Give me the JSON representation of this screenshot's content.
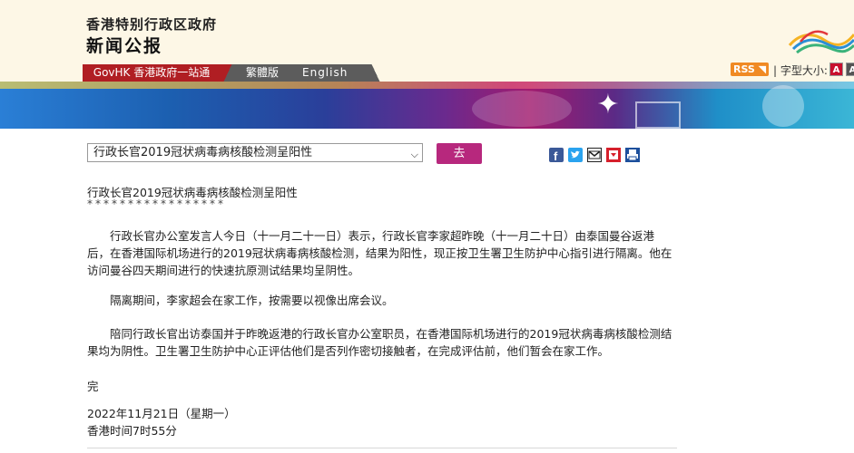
{
  "header": {
    "org_title": "香港特别行政区政府",
    "section_title": "新闻公报"
  },
  "nav": {
    "govhk": "GovHK 香港政府一站通",
    "traditional": "繁體版",
    "english": "English"
  },
  "tools": {
    "rss": "RSS",
    "font_size_label": "| 字型大小:",
    "font_a": "A",
    "font_a2": "A"
  },
  "select": {
    "value": "行政长官2019冠状病毒病核酸检测呈阳性",
    "go_label": "去"
  },
  "share_icons": [
    "facebook-icon",
    "twitter-icon",
    "email-icon",
    "weibo-icon",
    "print-icon"
  ],
  "article": {
    "headline": "行政长官2019冠状病毒病核酸检测呈阳性",
    "stars": "*****************",
    "paragraphs": [
      "行政长官办公室发言人今日（十一月二十一日）表示，行政长官李家超昨晚（十一月二十日）由泰国曼谷返港后，在香港国际机场进行的2019冠状病毒病核酸检测，结果为阳性，现正按卫生署卫生防护中心指引进行隔离。他在访问曼谷四天期间进行的快速抗原测试结果均呈阴性。",
      "隔离期间，李家超会在家工作，按需要以视像出席会议。",
      "陪同行政长官出访泰国并于昨晚返港的行政长官办公室职员，在香港国际机场进行的2019冠状病毒病核酸检测结果均为阴性。卫生署卫生防护中心正评估他们是否列作密切接触者，在完成评估前，他们暂会在家工作。"
    ],
    "end_mark": "完",
    "date": "2022年11月21日（星期一）",
    "time": "香港时间7时55分"
  },
  "colors": {
    "govhk_red": "#b01e23",
    "nav_gray": "#5c5c5c",
    "go_button": "#b7287d",
    "header_bg": "#fdf7e6"
  }
}
